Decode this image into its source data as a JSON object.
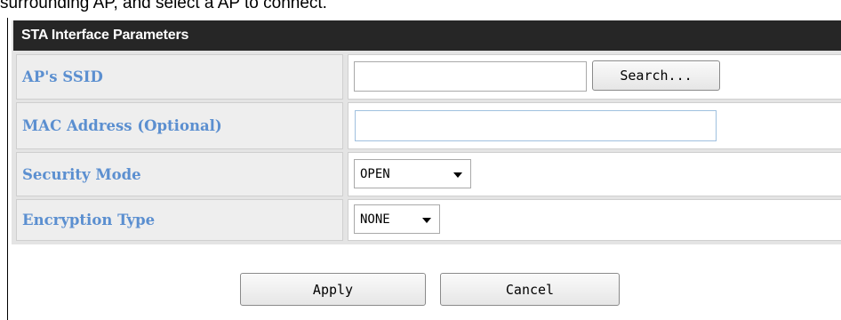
{
  "intro_text": "surrounding AP, and select a AP to connect.",
  "section": {
    "title": "STA Interface Parameters"
  },
  "fields": {
    "ssid": {
      "label": "AP's SSID",
      "value": "",
      "search_label": "Search..."
    },
    "mac": {
      "label": "MAC Address (Optional)",
      "value": ""
    },
    "security_mode": {
      "label": "Security Mode",
      "selected": "OPEN"
    },
    "encryption_type": {
      "label": "Encryption Type",
      "selected": "NONE"
    }
  },
  "actions": {
    "apply_label": "Apply",
    "cancel_label": "Cancel"
  },
  "icons": {
    "dropdown": "chevron-down-icon"
  },
  "colors": {
    "header_bg": "#262626",
    "label_text": "#5b8fd0",
    "label_bg": "#eeeeee"
  }
}
